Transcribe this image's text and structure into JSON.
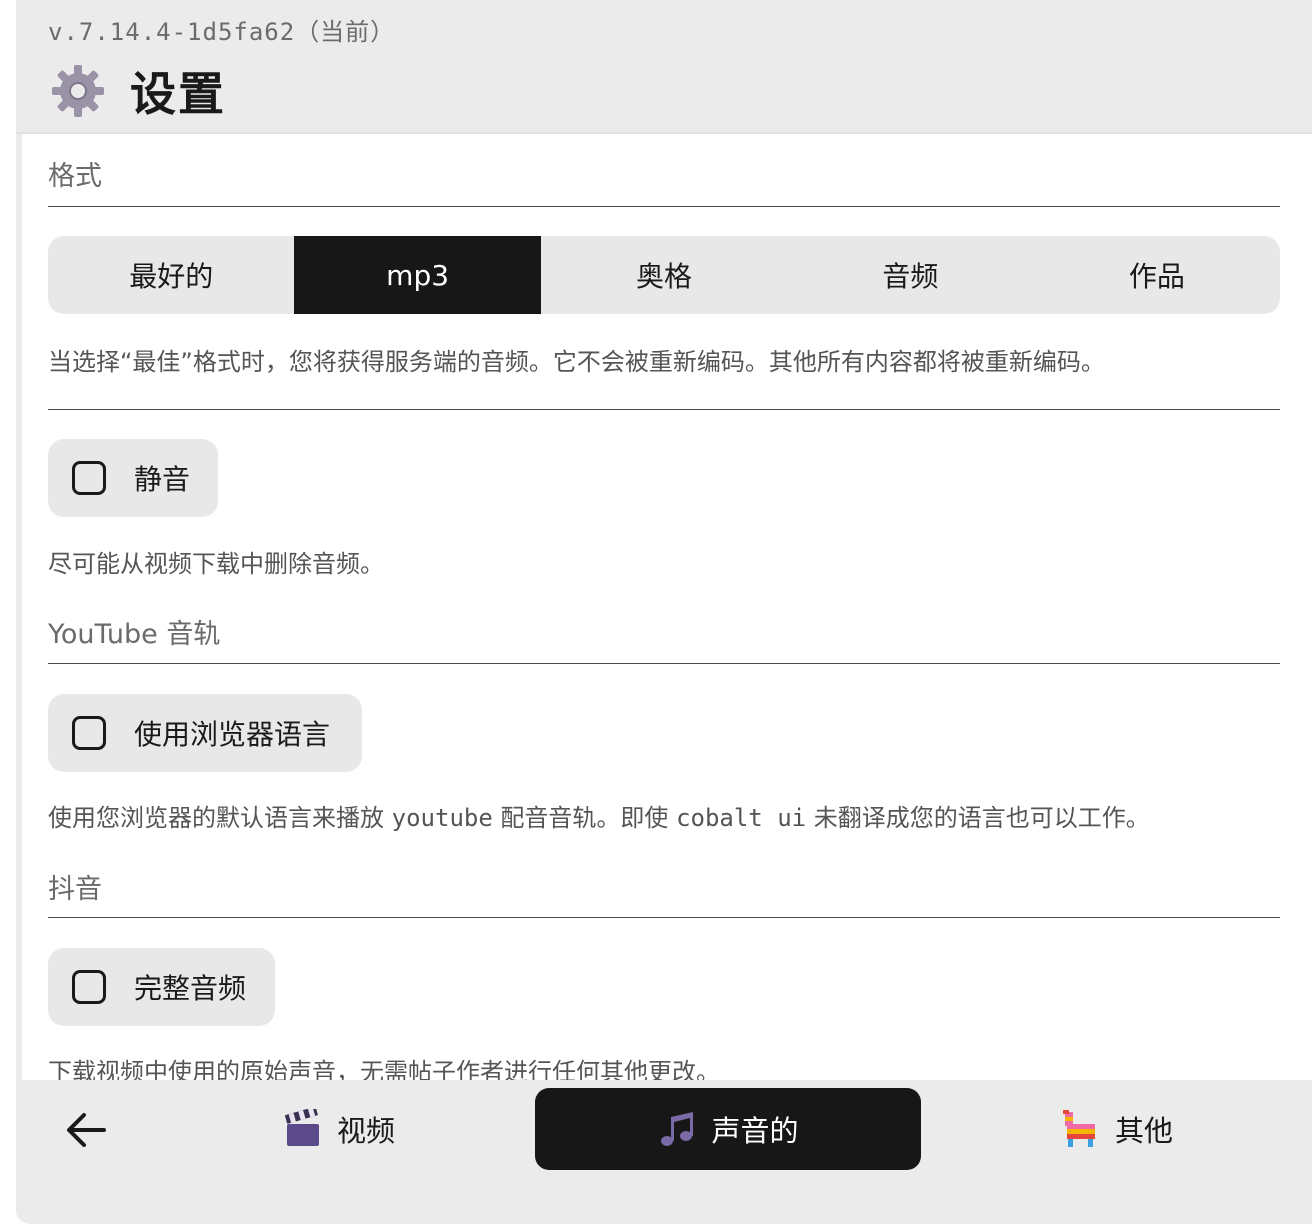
{
  "header": {
    "version": "v.7.14.4-1d5fa62（当前）",
    "title": "设置",
    "icon": "gear-icon"
  },
  "format_section": {
    "title": "格式",
    "options": [
      "最好的",
      "mp3",
      "奥格",
      "音频",
      "作品"
    ],
    "selected": "mp3",
    "description": "当选择“最佳”格式时，您将获得服务端的音频。它不会被重新编码。其他所有内容都将被重新编码。"
  },
  "mute": {
    "label": "静音",
    "checked": false,
    "description": "尽可能从视频下载中删除音频。"
  },
  "youtube_section": {
    "title": "YouTube 音轨",
    "toggle_label": "使用浏览器语言",
    "checked": false,
    "desc_part1": "使用您浏览器的默认语言来播放 ",
    "desc_code1": "youtube",
    "desc_part2": " 配音音轨。即使 ",
    "desc_code2": "cobalt ui",
    "desc_part3": " 未翻译成您的语言也可以工作。"
  },
  "tiktok_section": {
    "title": "抖音",
    "toggle_label": "完整音频",
    "checked": false,
    "description": "下载视频中使用的原始声音，无需帖子作者进行任何其他更改。"
  },
  "nav": {
    "back_icon": "arrow-left-icon",
    "tabs": [
      {
        "label": "视频",
        "icon": "clapper-board-icon"
      },
      {
        "label": "声音的",
        "icon": "music-notes-icon",
        "active": true
      },
      {
        "label": "其他",
        "icon": "pinata-icon"
      }
    ]
  }
}
